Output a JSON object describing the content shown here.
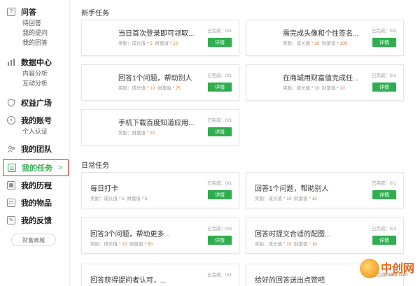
{
  "sidebar": {
    "qa": {
      "label": "问答",
      "icon": "question-icon",
      "subs": [
        "待回答",
        "我的提问",
        "我的回答"
      ]
    },
    "data_center": {
      "label": "数据中心",
      "icon": "bar-chart-icon",
      "subs": [
        "内容分析",
        "互动分析"
      ]
    },
    "rights": {
      "label": "权益广场",
      "icon": "shield-icon"
    },
    "account": {
      "label": "我的账号",
      "icon": "user-circle-icon",
      "subs": [
        "个人认证"
      ]
    },
    "team": {
      "label": "我的团队",
      "icon": "team-icon"
    },
    "tasks": {
      "label": "我的任务",
      "icon": "task-icon",
      "chevron": ">"
    },
    "history": {
      "label": "我的历程",
      "icon": "calendar-icon"
    },
    "items": {
      "label": "我的物品",
      "icon": "bag-icon"
    },
    "feedback": {
      "label": "我的反馈",
      "icon": "edit-icon"
    },
    "store_button": "财富商城"
  },
  "newbie": {
    "title": "新手任务",
    "cards": [
      {
        "title": "当日首次登录即可领取...",
        "reward_prefix": "奖励：",
        "growth_label": "成长值",
        "growth": "* 5",
        "wealth_label": "财富值",
        "wealth": "* 10",
        "status": "已完成：0/1",
        "button": "详情"
      },
      {
        "title": "需完成头像和个性签名...",
        "reward_prefix": "奖励：",
        "growth_label": "成长值",
        "growth": "* 20",
        "wealth_label": "财富值",
        "wealth": "* 100",
        "status": "已完成：0/2",
        "button": "详情"
      },
      {
        "title": "回答1个问题，帮助别人",
        "reward_prefix": "奖励：",
        "growth_label": "成长值",
        "growth": "* 10",
        "wealth_label": "财富值",
        "wealth": "* 25",
        "status": "已完成：0/1",
        "button": "详情"
      },
      {
        "title": "在商城用财富值完成任...",
        "reward_prefix": "奖励：",
        "growth_label": "成长值",
        "growth": "* 10",
        "wealth_label": "财富值",
        "wealth": "* 10",
        "status": "已完成：0/1",
        "button": "详情"
      },
      {
        "title": "手机下载百度知道应用...",
        "reward_prefix": "奖励：",
        "growth_label": "",
        "growth": "",
        "wealth_label": "财富值",
        "wealth": "* 20",
        "status": "已完成：0/1",
        "button": "详情"
      }
    ]
  },
  "daily": {
    "title": "日常任务",
    "cards": [
      {
        "title": "每日打卡",
        "reward_prefix": "奖励：",
        "growth_label": "成长值",
        "growth": "* 5",
        "wealth_label": "财富值",
        "wealth": "* 5",
        "status": "已完成：0/1",
        "button": "详情"
      },
      {
        "title": "回答1个问题，帮助别人",
        "reward_prefix": "奖励：",
        "growth_label": "成长值",
        "growth": "* 10",
        "wealth_label": "财富值",
        "wealth": "* 10",
        "status": "已完成：0/1",
        "button": "详情"
      },
      {
        "title": "回答3个问题，帮助更多...",
        "reward_prefix": "奖励：",
        "growth_label": "成长值",
        "growth": "* 20",
        "wealth_label": "财富值",
        "wealth": "* 50",
        "status": "已完成：0/3",
        "button": "详情"
      },
      {
        "title": "回答时提交合适的配图...",
        "reward_prefix": "奖励：",
        "growth_label": "成长值",
        "growth": "* 10",
        "wealth_label": "财富值",
        "wealth": "* 10",
        "status": "已完成：0/1",
        "button": "详情"
      },
      {
        "title": "回答获得提问者认可，...",
        "reward_prefix": "",
        "growth_label": "",
        "growth": "",
        "wealth_label": "",
        "wealth": "",
        "status": "已完成：0/1",
        "button": ""
      },
      {
        "title": "给好的回答送出点赞吧",
        "reward_prefix": "",
        "growth_label": "",
        "growth": "",
        "wealth_label": "",
        "wealth": "",
        "status": "已完成：0/1",
        "button": ""
      }
    ]
  },
  "watermark": {
    "name": "中创网",
    "url": "You85.com"
  },
  "colors": {
    "accent": "#2fae4f",
    "highlight_border": "#d9332f",
    "reward_value": "#e07b2e"
  }
}
